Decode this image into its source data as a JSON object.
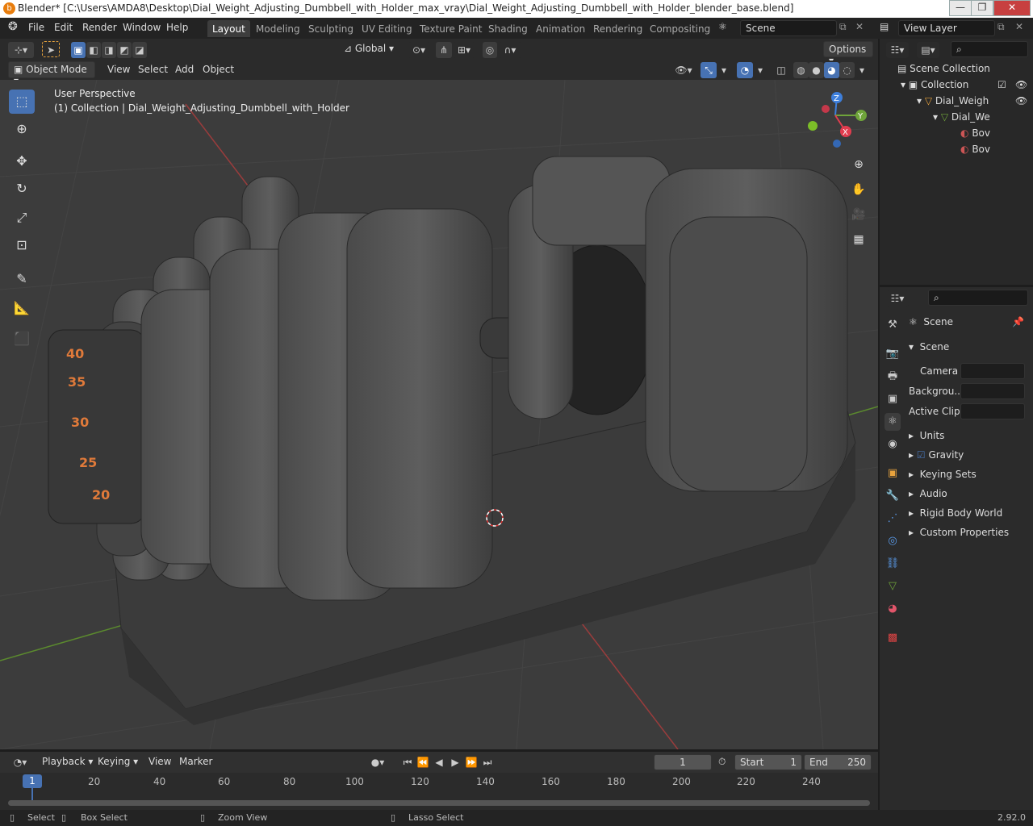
{
  "window": {
    "title": "Blender* [C:\\Users\\AMDA8\\Desktop\\Dial_Weight_Adjusting_Dumbbell_with_Holder_max_vray\\Dial_Weight_Adjusting_Dumbbell_with_Holder_blender_base.blend]",
    "minimize": "—",
    "maximize": "❐",
    "close": "✕"
  },
  "menu": [
    "File",
    "Edit",
    "Render",
    "Window",
    "Help"
  ],
  "workspaces": [
    "Layout",
    "Modeling",
    "Sculpting",
    "UV Editing",
    "Texture Paint",
    "Shading",
    "Animation",
    "Rendering",
    "Compositing"
  ],
  "scene_field": "Scene",
  "view_layer_field": "View Layer",
  "vp_header": {
    "transform_orientation": "Global",
    "options": "Options"
  },
  "vp_header2": {
    "mode": "Object Mode",
    "view": "View",
    "select": "Select",
    "add": "Add",
    "object": "Object"
  },
  "overlay": {
    "line1": "User Perspective",
    "line2": "(1) Collection | Dial_Weight_Adjusting_Dumbbell_with_Holder"
  },
  "gizmo": {
    "x": "X",
    "y": "Y",
    "z": "Z"
  },
  "dial_numbers": [
    "40",
    "35",
    "30",
    "25",
    "20"
  ],
  "outliner": {
    "root": "Scene Collection",
    "collection": "Collection",
    "object": "Dial_Weigh",
    "mesh": "Dial_We",
    "mat1": "Bov",
    "mat2": "Bov"
  },
  "properties": {
    "context": "Scene",
    "panel": "Scene",
    "camera_label": "Camera",
    "background_label": "Backgrou...",
    "active_clip_label": "Active Clip",
    "sections": [
      "Units",
      "Gravity",
      "Keying Sets",
      "Audio",
      "Rigid Body World",
      "Custom Properties"
    ]
  },
  "timeline": {
    "playback": "Playback",
    "keying": "Keying",
    "view": "View",
    "marker": "Marker",
    "current_frame": "1",
    "start_label": "Start",
    "start": "1",
    "end_label": "End",
    "end": "250",
    "ticks": [
      "20",
      "40",
      "60",
      "80",
      "100",
      "120",
      "140",
      "160",
      "180",
      "200",
      "220",
      "240"
    ],
    "playhead": "1"
  },
  "status": {
    "select": "Select",
    "box_select": "Box Select",
    "zoom_view": "Zoom View",
    "lasso_select": "Lasso Select",
    "version": "2.92.0"
  },
  "colors": {
    "accent": "#4772b3",
    "orange": "#e87d0d",
    "x_axis": "#e23d4f",
    "y_axis": "#6fa43a",
    "z_axis": "#3e7fdb"
  }
}
